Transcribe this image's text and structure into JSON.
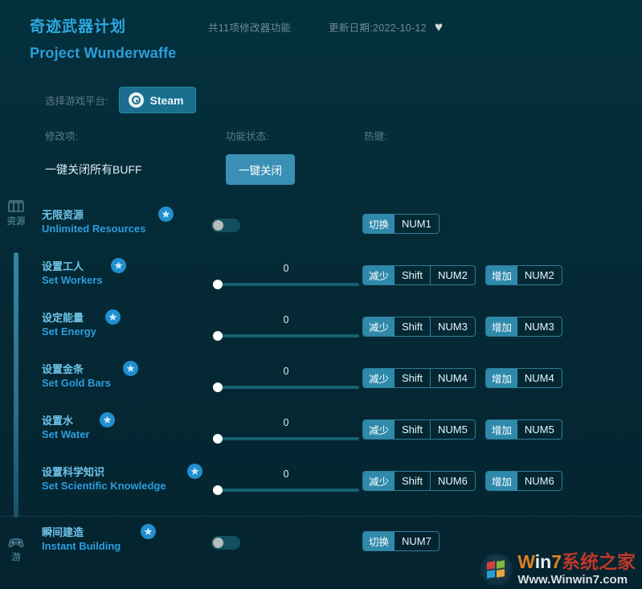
{
  "header": {
    "title_cn": "奇迹武器计划",
    "title_en": "Project Wunderwaffe",
    "feature_count": "共11项修改器功能",
    "update_date": "更新日期:2022-10-12",
    "favorite_icon": "heart-icon"
  },
  "platform": {
    "label": "选择游戏平台:",
    "selected": "Steam"
  },
  "columns": {
    "mod_item": "修改项:",
    "status": "功能状态:",
    "hotkey": "热键:"
  },
  "global_buff": {
    "label": "一键关闭所有BUFF",
    "button": "一键关闭"
  },
  "sidebar": {
    "items": [
      {
        "icon": "resources-icon",
        "label": "资源"
      },
      {
        "icon": "gamepad-icon",
        "label": "游"
      }
    ]
  },
  "rows": [
    {
      "cn": "无限资源",
      "en": "Unlimited Resources",
      "control": "toggle",
      "toggle_on": false,
      "keys": [
        {
          "action": "切换",
          "combo": [
            "NUM1"
          ]
        }
      ]
    },
    {
      "cn": "设置工人",
      "en": "Set Workers",
      "control": "slider",
      "value": "0",
      "keys": [
        {
          "action": "减少",
          "combo": [
            "Shift",
            "NUM2"
          ]
        },
        {
          "action": "增加",
          "combo": [
            "NUM2"
          ]
        }
      ]
    },
    {
      "cn": "设定能量",
      "en": "Set Energy",
      "control": "slider",
      "value": "0",
      "keys": [
        {
          "action": "减少",
          "combo": [
            "Shift",
            "NUM3"
          ]
        },
        {
          "action": "增加",
          "combo": [
            "NUM3"
          ]
        }
      ]
    },
    {
      "cn": "设置金条",
      "en": "Set Gold Bars",
      "control": "slider",
      "value": "0",
      "keys": [
        {
          "action": "减少",
          "combo": [
            "Shift",
            "NUM4"
          ]
        },
        {
          "action": "增加",
          "combo": [
            "NUM4"
          ]
        }
      ]
    },
    {
      "cn": "设置水",
      "en": "Set Water",
      "control": "slider",
      "value": "0",
      "keys": [
        {
          "action": "减少",
          "combo": [
            "Shift",
            "NUM5"
          ]
        },
        {
          "action": "增加",
          "combo": [
            "NUM5"
          ]
        }
      ]
    },
    {
      "cn": "设置科学知识",
      "en": "Set Scientific Knowledge",
      "control": "slider",
      "value": "0",
      "keys": [
        {
          "action": "减少",
          "combo": [
            "Shift",
            "NUM6"
          ]
        },
        {
          "action": "增加",
          "combo": [
            "NUM6"
          ]
        }
      ]
    },
    {
      "cn": "瞬间建造",
      "en": "Instant Building",
      "control": "toggle",
      "toggle_on": false,
      "keys": [
        {
          "action": "切换",
          "combo": [
            "NUM7"
          ]
        }
      ]
    }
  ],
  "watermark": {
    "brand_w": "W",
    "brand_in": "in",
    "brand_7": "7",
    "brand_cn": "系统之家",
    "url": "Www.Winwin7.com"
  },
  "colors": {
    "background": "#042a36",
    "accent": "#2e9ddd",
    "accent_button": "#2f89ab",
    "label_muted": "#5d7b87"
  }
}
